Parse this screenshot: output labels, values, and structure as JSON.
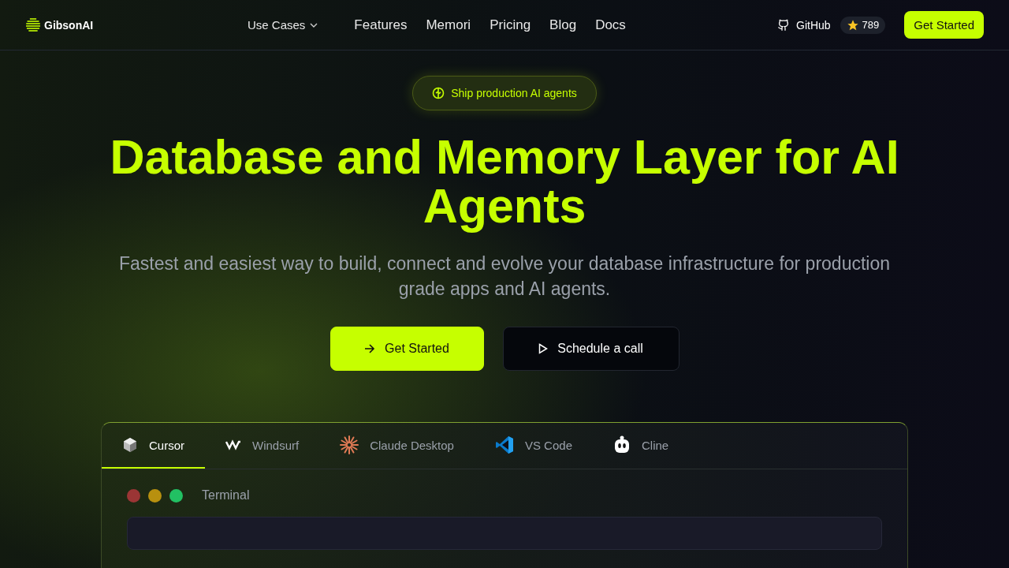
{
  "nav": {
    "brand": "GibsonAI",
    "menu": [
      {
        "label": "Use Cases",
        "kind": "dropdown"
      },
      {
        "label": "Features",
        "kind": "link"
      },
      {
        "label": "Memori",
        "kind": "link"
      },
      {
        "label": "Pricing",
        "kind": "link"
      },
      {
        "label": "Blog",
        "kind": "link"
      },
      {
        "label": "Docs",
        "kind": "link"
      }
    ],
    "github": {
      "label": "GitHub",
      "stars": "789"
    },
    "cta": "Get Started"
  },
  "hero": {
    "badge": "Ship production AI agents",
    "title": "Database and Memory Layer for AI Agents",
    "subtitle": "Fastest and easiest way to build, connect and evolve your database infrastructure for production grade apps and AI agents.",
    "buttons": [
      {
        "label": "Get Started",
        "kind": "primary"
      },
      {
        "label": "Schedule a call",
        "kind": "secondary"
      }
    ]
  },
  "panel": {
    "tabs": [
      {
        "label": "Cursor",
        "kind": "cursor",
        "selected": true
      },
      {
        "label": "Windsurf",
        "kind": "windsurf",
        "selected": false
      },
      {
        "label": "Claude Desktop",
        "kind": "claude",
        "selected": false
      },
      {
        "label": "VS Code",
        "kind": "vscode",
        "selected": false
      },
      {
        "label": "Cline",
        "kind": "cline",
        "selected": false
      }
    ],
    "terminal": {
      "title": "Terminal",
      "dots": [
        {
          "color": "#9b3535"
        },
        {
          "color": "#b8900f"
        },
        {
          "color": "#22c063"
        }
      ]
    }
  }
}
